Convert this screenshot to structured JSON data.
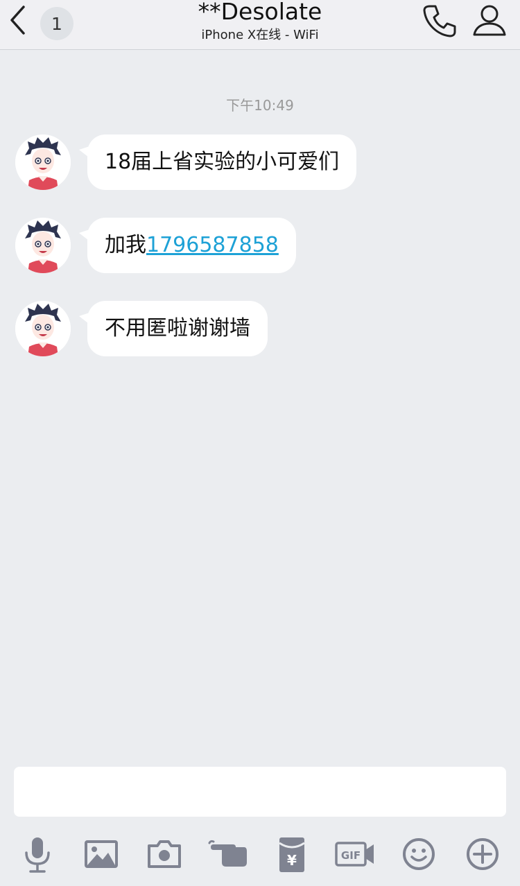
{
  "header": {
    "unread_count": "1",
    "title": "**Desolate",
    "status": "iPhone X在线 - WiFi"
  },
  "chat": {
    "timestamp": "下午10:49",
    "messages": [
      {
        "text": "18届上省实验的小可爱们"
      },
      {
        "prefix": "加我",
        "link": "1796587858"
      },
      {
        "text": "不用匿啦谢谢墙"
      }
    ]
  },
  "input": {
    "placeholder": ""
  },
  "toolbar": {
    "icons": [
      "microphone-icon",
      "image-icon",
      "camera-icon",
      "poke-icon",
      "red-packet-icon",
      "gif-icon",
      "emoji-icon",
      "plus-icon"
    ],
    "gif_label": "GIF",
    "red_packet_label": "¥"
  },
  "colors": {
    "background": "#ebedf0",
    "header": "#f0f0f3",
    "link": "#1da1d6",
    "icon": "#7f8391"
  }
}
